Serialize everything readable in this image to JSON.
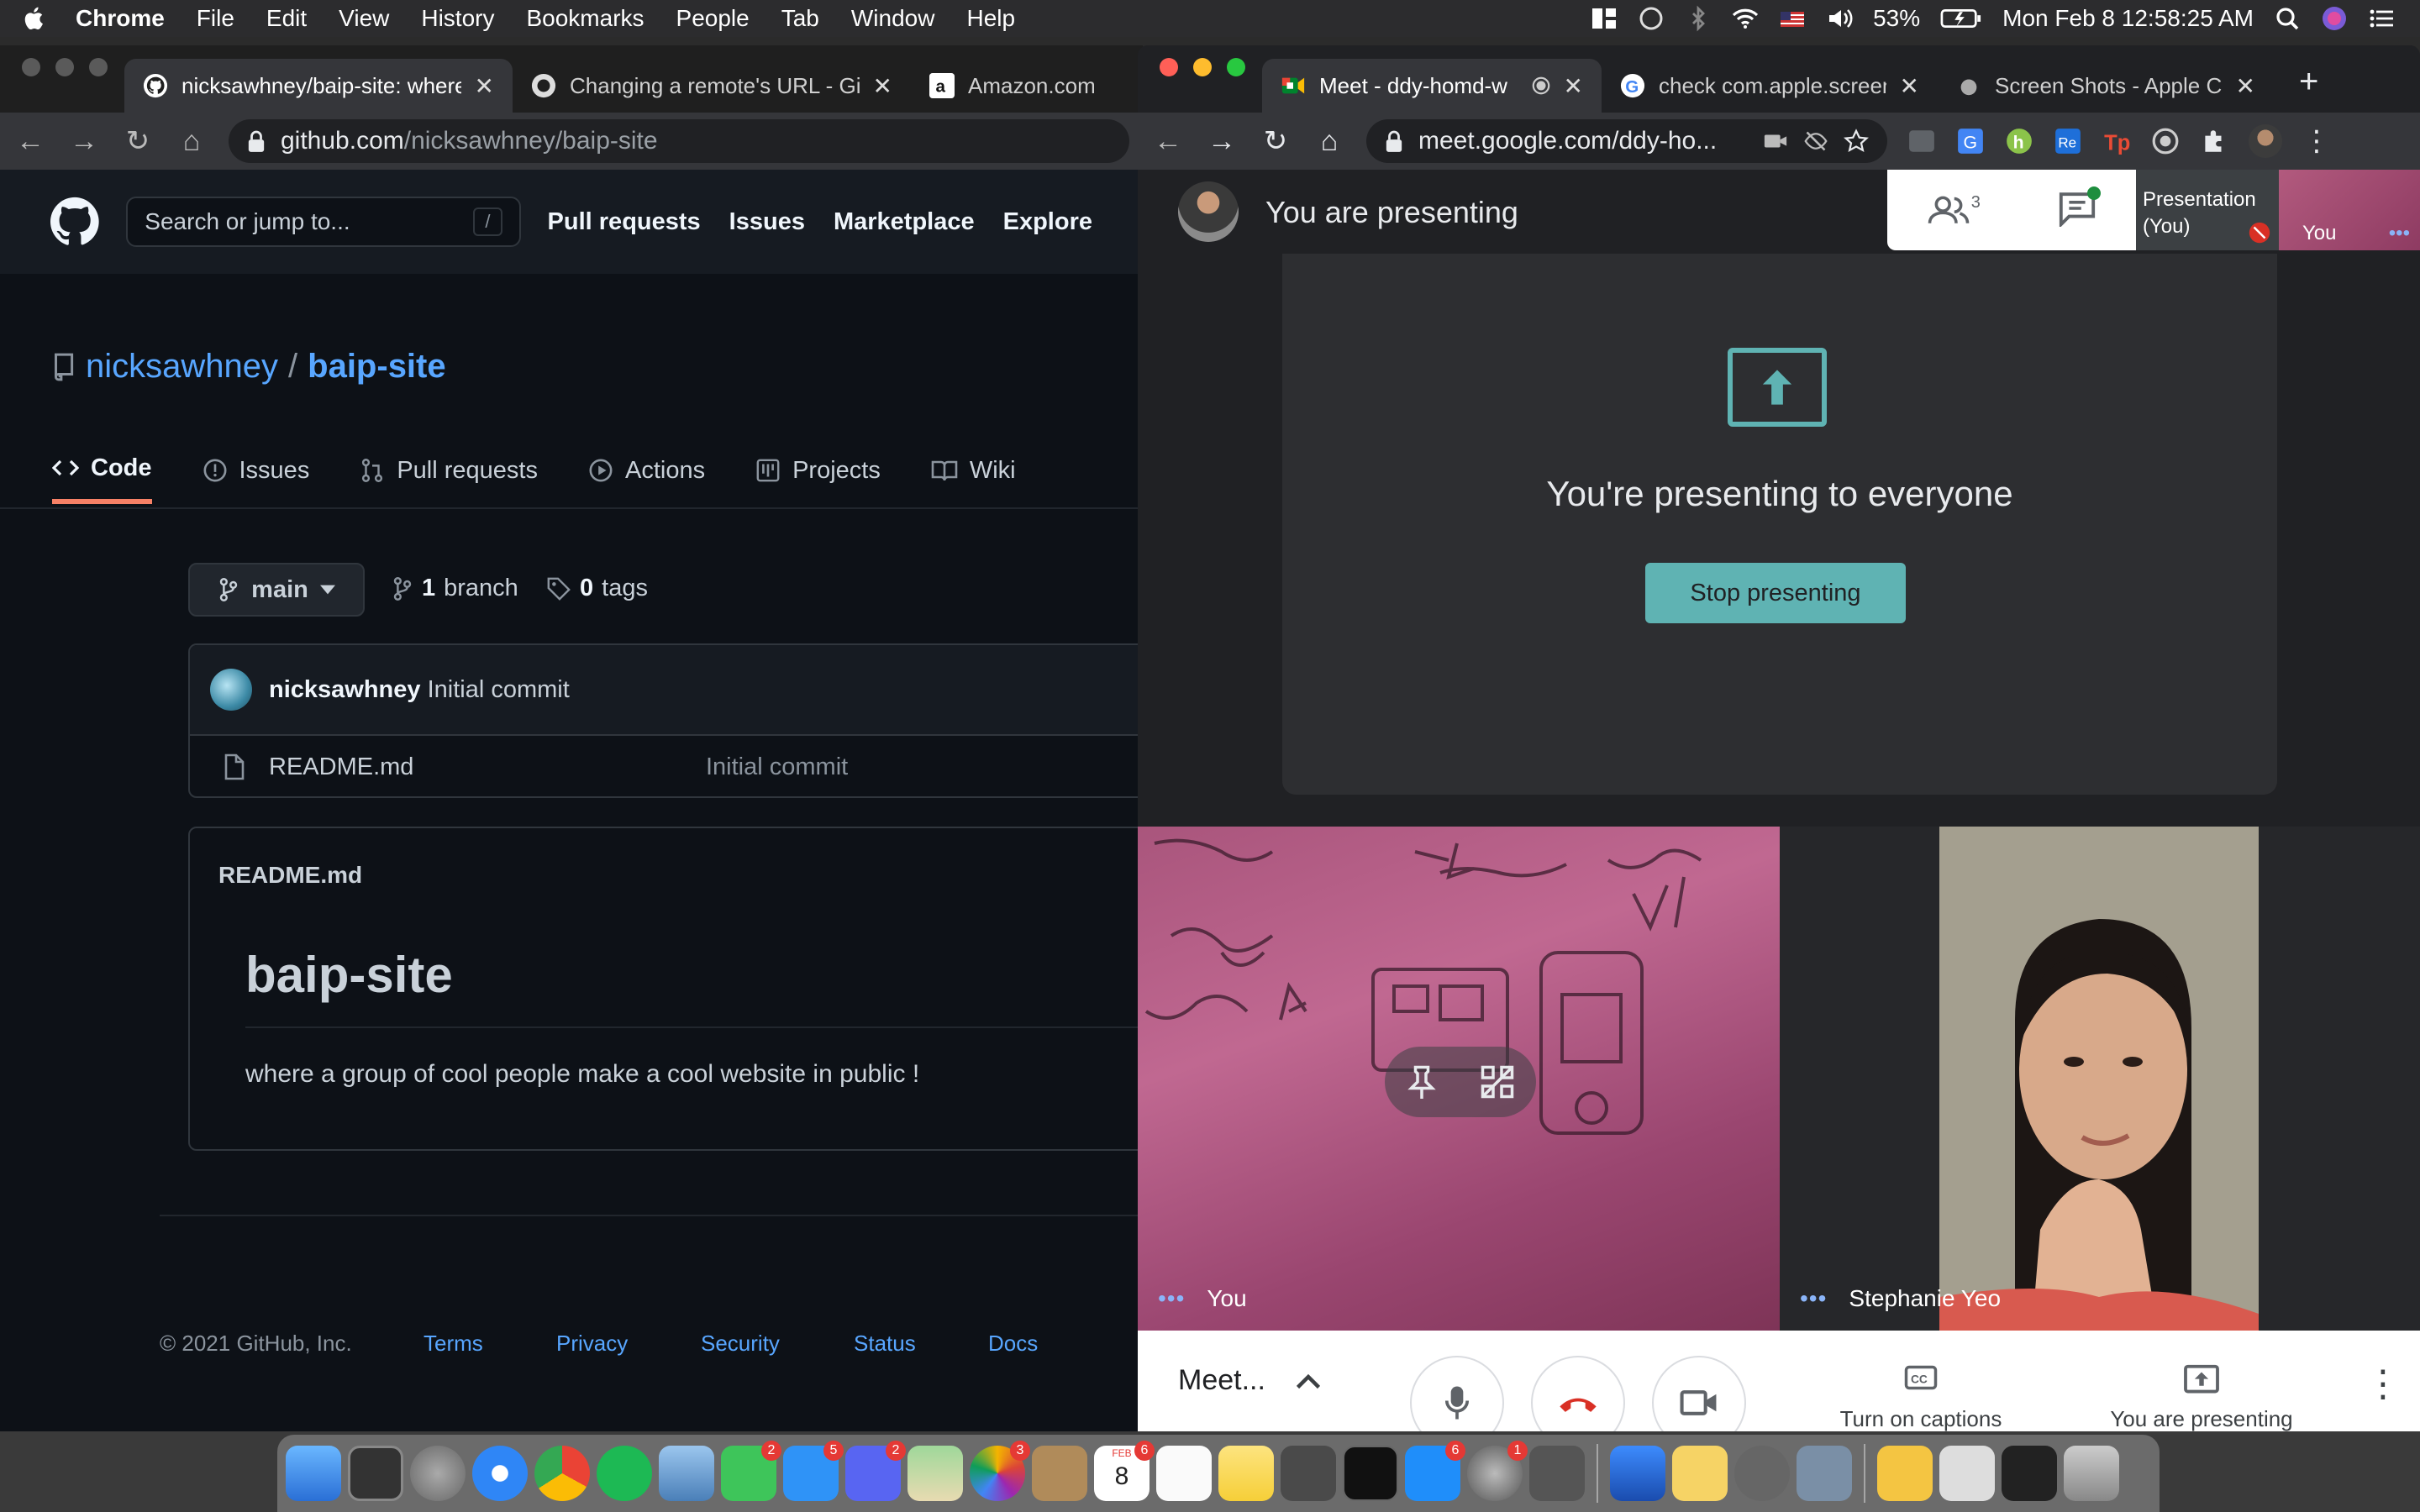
{
  "menubar": {
    "items": [
      "Chrome",
      "File",
      "Edit",
      "View",
      "History",
      "Bookmarks",
      "People",
      "Tab",
      "Window",
      "Help"
    ],
    "battery": "53%",
    "clock": "Mon Feb 8  12:58:25 AM"
  },
  "github_window": {
    "tabs": [
      {
        "title": "nicksawhney/baip-site: where a",
        "active": true
      },
      {
        "title": "Changing a remote's URL - Git",
        "active": false
      },
      {
        "title": "Amazon.com: U",
        "active": false
      }
    ],
    "url_host": "github.com",
    "url_path": "/nicksawhney/baip-site",
    "search_placeholder": "Search or jump to...",
    "search_key": "/",
    "nav": [
      "Pull requests",
      "Issues",
      "Marketplace",
      "Explore"
    ],
    "owner": "nicksawhney",
    "separator": "/",
    "repo": "baip-site",
    "repo_tabs": [
      "Code",
      "Issues",
      "Pull requests",
      "Actions",
      "Projects",
      "Wiki"
    ],
    "branch": "main",
    "branch_count": "1",
    "branch_word": "branch",
    "tag_count": "0",
    "tag_word": "tags",
    "commit_author": "nicksawhney",
    "commit_message": "Initial commit",
    "files": [
      {
        "name": "README.md",
        "message": "Initial commit"
      }
    ],
    "readme_header": "README.md",
    "readme_title": "baip-site",
    "readme_body": "where a group of cool people make a cool website in public !",
    "footer_copyright": "© 2021 GitHub, Inc.",
    "footer_links": [
      "Terms",
      "Privacy",
      "Security",
      "Status",
      "Docs"
    ]
  },
  "meet_window": {
    "tabs": [
      {
        "title": "Meet - ddy-homd-w",
        "active": true
      },
      {
        "title": "check com.apple.screen",
        "active": false
      },
      {
        "title": "Screen Shots - Apple C",
        "active": false
      }
    ],
    "url": "meet.google.com/ddy-ho...",
    "top_title": "You are presenting",
    "participants_count": "3",
    "thumb_presentation": "Presentation (You)",
    "thumb_you": "You",
    "presenting_heading": "You're presenting to everyone",
    "stop_button": "Stop presenting",
    "tile_you_label": "You",
    "tile_other_label": "Stephanie Yeo",
    "meeting_name": "Meet...",
    "captions_label": "Turn on captions",
    "presenting_label": "You are presenting",
    "accent": "#5fb3b3"
  },
  "dock": {
    "badges": {
      "facetime": "2",
      "messages": "5",
      "discord": "2",
      "photos": "3",
      "calendar": "6",
      "prefs": "1",
      "appstore": "6"
    },
    "calendar_month": "FEB",
    "calendar_day": "8"
  }
}
